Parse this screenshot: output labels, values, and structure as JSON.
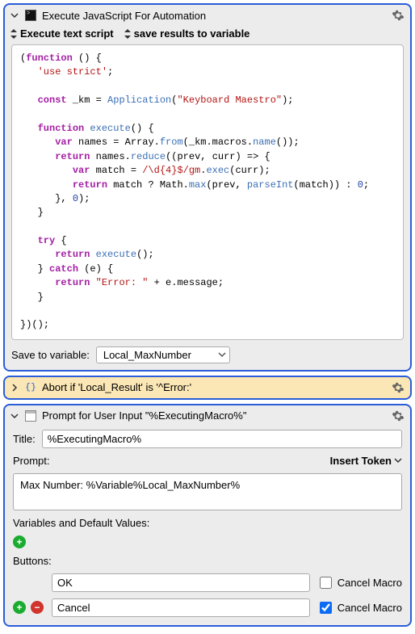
{
  "actions": {
    "execute_js": {
      "title": "Execute JavaScript For Automation",
      "opt_script": "Execute text script",
      "opt_save": "save results to variable",
      "save_label": "Save to variable:",
      "save_value": "Local_MaxNumber"
    },
    "abort": {
      "title": "Abort if 'Local_Result' is '^Error:'"
    },
    "prompt": {
      "title": "Prompt for User Input \"%ExecutingMacro%\"",
      "title_label": "Title:",
      "title_value": "%ExecutingMacro%",
      "prompt_label": "Prompt:",
      "insert_token": "Insert Token",
      "prompt_text": "Max Number: %Variable%Local_MaxNumber%",
      "vars_label": "Variables and Default Values:",
      "buttons_label": "Buttons:",
      "cancel_macro_label1": "Cancel Macro",
      "cancel_macro_label2": "Cancel Macro",
      "btn1_value": "OK",
      "btn1_checked": false,
      "btn2_value": "Cancel",
      "btn2_checked": true
    }
  },
  "code": {
    "lines": [
      {
        "t": [
          {
            "c": "op",
            "s": "("
          },
          {
            "c": "kw",
            "s": "function"
          },
          {
            "c": "op",
            "s": " () {"
          }
        ]
      },
      {
        "i": 1,
        "t": [
          {
            "c": "str",
            "s": "'use strict'"
          },
          {
            "c": "op",
            "s": ";"
          }
        ]
      },
      {
        "t": []
      },
      {
        "i": 1,
        "t": [
          {
            "c": "kw",
            "s": "const"
          },
          {
            "c": "op",
            "s": " _km = "
          },
          {
            "c": "fn",
            "s": "Application"
          },
          {
            "c": "op",
            "s": "("
          },
          {
            "c": "str",
            "s": "\"Keyboard Maestro\""
          },
          {
            "c": "op",
            "s": ");"
          }
        ]
      },
      {
        "t": []
      },
      {
        "i": 1,
        "t": [
          {
            "c": "kw",
            "s": "function"
          },
          {
            "c": "op",
            "s": " "
          },
          {
            "c": "fn",
            "s": "execute"
          },
          {
            "c": "op",
            "s": "() {"
          }
        ]
      },
      {
        "i": 2,
        "t": [
          {
            "c": "kw",
            "s": "var"
          },
          {
            "c": "op",
            "s": " names = Array."
          },
          {
            "c": "fn",
            "s": "from"
          },
          {
            "c": "op",
            "s": "(_km.macros."
          },
          {
            "c": "fn",
            "s": "name"
          },
          {
            "c": "op",
            "s": "());"
          }
        ]
      },
      {
        "i": 2,
        "t": [
          {
            "c": "kw",
            "s": "return"
          },
          {
            "c": "op",
            "s": " names."
          },
          {
            "c": "fn",
            "s": "reduce"
          },
          {
            "c": "op",
            "s": "((prev, curr) => {"
          }
        ]
      },
      {
        "i": 3,
        "t": [
          {
            "c": "kw",
            "s": "var"
          },
          {
            "c": "op",
            "s": " match = "
          },
          {
            "c": "str",
            "s": "/\\d{4}$/gm"
          },
          {
            "c": "op",
            "s": "."
          },
          {
            "c": "fn",
            "s": "exec"
          },
          {
            "c": "op",
            "s": "(curr);"
          }
        ]
      },
      {
        "i": 3,
        "t": [
          {
            "c": "kw",
            "s": "return"
          },
          {
            "c": "op",
            "s": " match ? Math."
          },
          {
            "c": "fn",
            "s": "max"
          },
          {
            "c": "op",
            "s": "(prev, "
          },
          {
            "c": "fn",
            "s": "parseInt"
          },
          {
            "c": "op",
            "s": "(match)) : "
          },
          {
            "c": "num",
            "s": "0"
          },
          {
            "c": "op",
            "s": ";"
          }
        ]
      },
      {
        "i": 2,
        "t": [
          {
            "c": "op",
            "s": "}, "
          },
          {
            "c": "num",
            "s": "0"
          },
          {
            "c": "op",
            "s": ");"
          }
        ]
      },
      {
        "i": 1,
        "t": [
          {
            "c": "op",
            "s": "}"
          }
        ]
      },
      {
        "t": []
      },
      {
        "i": 1,
        "t": [
          {
            "c": "kw",
            "s": "try"
          },
          {
            "c": "op",
            "s": " {"
          }
        ]
      },
      {
        "i": 2,
        "t": [
          {
            "c": "kw",
            "s": "return"
          },
          {
            "c": "op",
            "s": " "
          },
          {
            "c": "fn",
            "s": "execute"
          },
          {
            "c": "op",
            "s": "();"
          }
        ]
      },
      {
        "i": 1,
        "t": [
          {
            "c": "op",
            "s": "} "
          },
          {
            "c": "kw",
            "s": "catch"
          },
          {
            "c": "op",
            "s": " (e) {"
          }
        ]
      },
      {
        "i": 2,
        "t": [
          {
            "c": "kw",
            "s": "return"
          },
          {
            "c": "op",
            "s": " "
          },
          {
            "c": "str",
            "s": "\"Error: \""
          },
          {
            "c": "op",
            "s": " + e.message;"
          }
        ]
      },
      {
        "i": 1,
        "t": [
          {
            "c": "op",
            "s": "}"
          }
        ]
      },
      {
        "t": []
      },
      {
        "t": [
          {
            "c": "op",
            "s": "})();"
          }
        ]
      }
    ]
  }
}
